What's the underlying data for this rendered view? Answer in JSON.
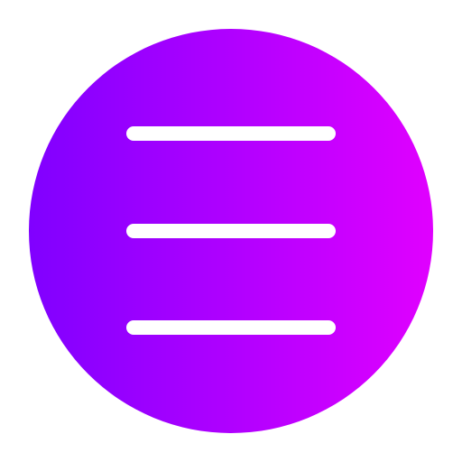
{
  "icon": {
    "name": "hamburger-menu-icon",
    "gradient_start": "#8000ff",
    "gradient_end": "#e000ff",
    "line_color": "#ffffff"
  }
}
